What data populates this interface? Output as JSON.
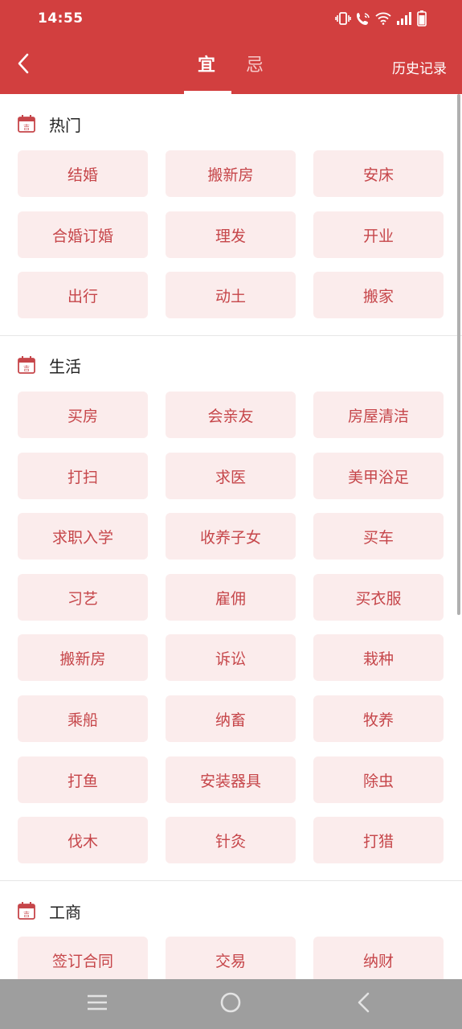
{
  "status_bar": {
    "time": "14:55",
    "icons": [
      "vibrate-icon",
      "wifi-call-icon",
      "wifi-icon",
      "signal-icon",
      "battery-icon"
    ]
  },
  "header": {
    "back_icon": "chevron-left-icon",
    "tabs": [
      {
        "label": "宜",
        "active": true
      },
      {
        "label": "忌",
        "active": false
      }
    ],
    "history_label": "历史记录"
  },
  "sections": [
    {
      "title": "热门",
      "icon": "calendar-icon",
      "items": [
        "结婚",
        "搬新房",
        "安床",
        "合婚订婚",
        "理发",
        "开业",
        "出行",
        "动土",
        "搬家"
      ]
    },
    {
      "title": "生活",
      "icon": "calendar-icon",
      "items": [
        "买房",
        "会亲友",
        "房屋清洁",
        "打扫",
        "求医",
        "美甲浴足",
        "求职入学",
        "收养子女",
        "买车",
        "习艺",
        "雇佣",
        "买衣服",
        "搬新房",
        "诉讼",
        "栽种",
        "乘船",
        "纳畜",
        "牧养",
        "打鱼",
        "安装器具",
        "除虫",
        "伐木",
        "针灸",
        "打猎"
      ]
    },
    {
      "title": "工商",
      "icon": "calendar-icon",
      "items": [
        "签订合同",
        "交易",
        "纳财"
      ]
    }
  ],
  "nav_bar": {
    "buttons": [
      "menu-icon",
      "home-circle-icon",
      "back-triangle-icon"
    ]
  },
  "colors": {
    "primary": "#d23f3f",
    "chip_bg": "#fbecec",
    "chip_text": "#c6464a",
    "nav_bg": "#9e9e9e"
  }
}
